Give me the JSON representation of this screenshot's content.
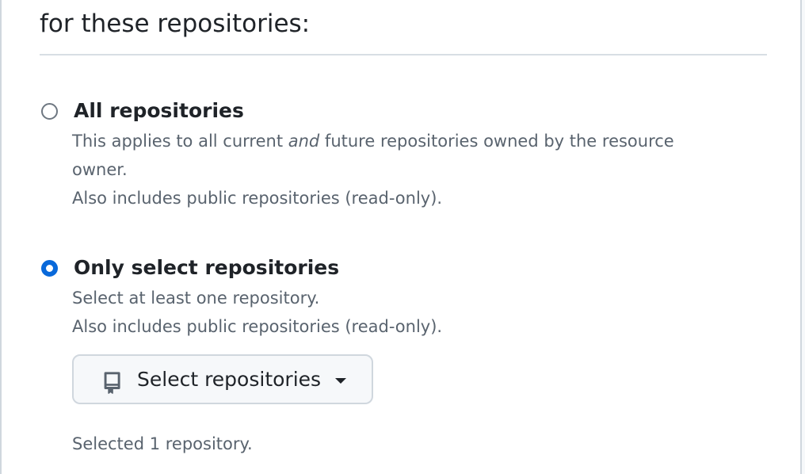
{
  "section": {
    "heading": "for these repositories:"
  },
  "options": [
    {
      "title": "All repositories",
      "selected": false,
      "desc_line1_before": "This applies to all current ",
      "desc_line1_em": "and",
      "desc_line1_after": " future repositories owned by the resource",
      "desc_line2": "owner.",
      "desc_line3": "Also includes public repositories (read-only)."
    },
    {
      "title": "Only select repositories",
      "selected": true,
      "desc_line1": "Select at least one repository.",
      "desc_line2": "Also includes public repositories (read-only)."
    }
  ],
  "select_button": {
    "label": "Select repositories",
    "icon": "repo-icon"
  },
  "status": {
    "selected_text": "Selected 1 repository."
  },
  "colors": {
    "accent": "#0969da",
    "text": "#1f2328",
    "muted": "#59636e",
    "border": "#d0d7de"
  }
}
